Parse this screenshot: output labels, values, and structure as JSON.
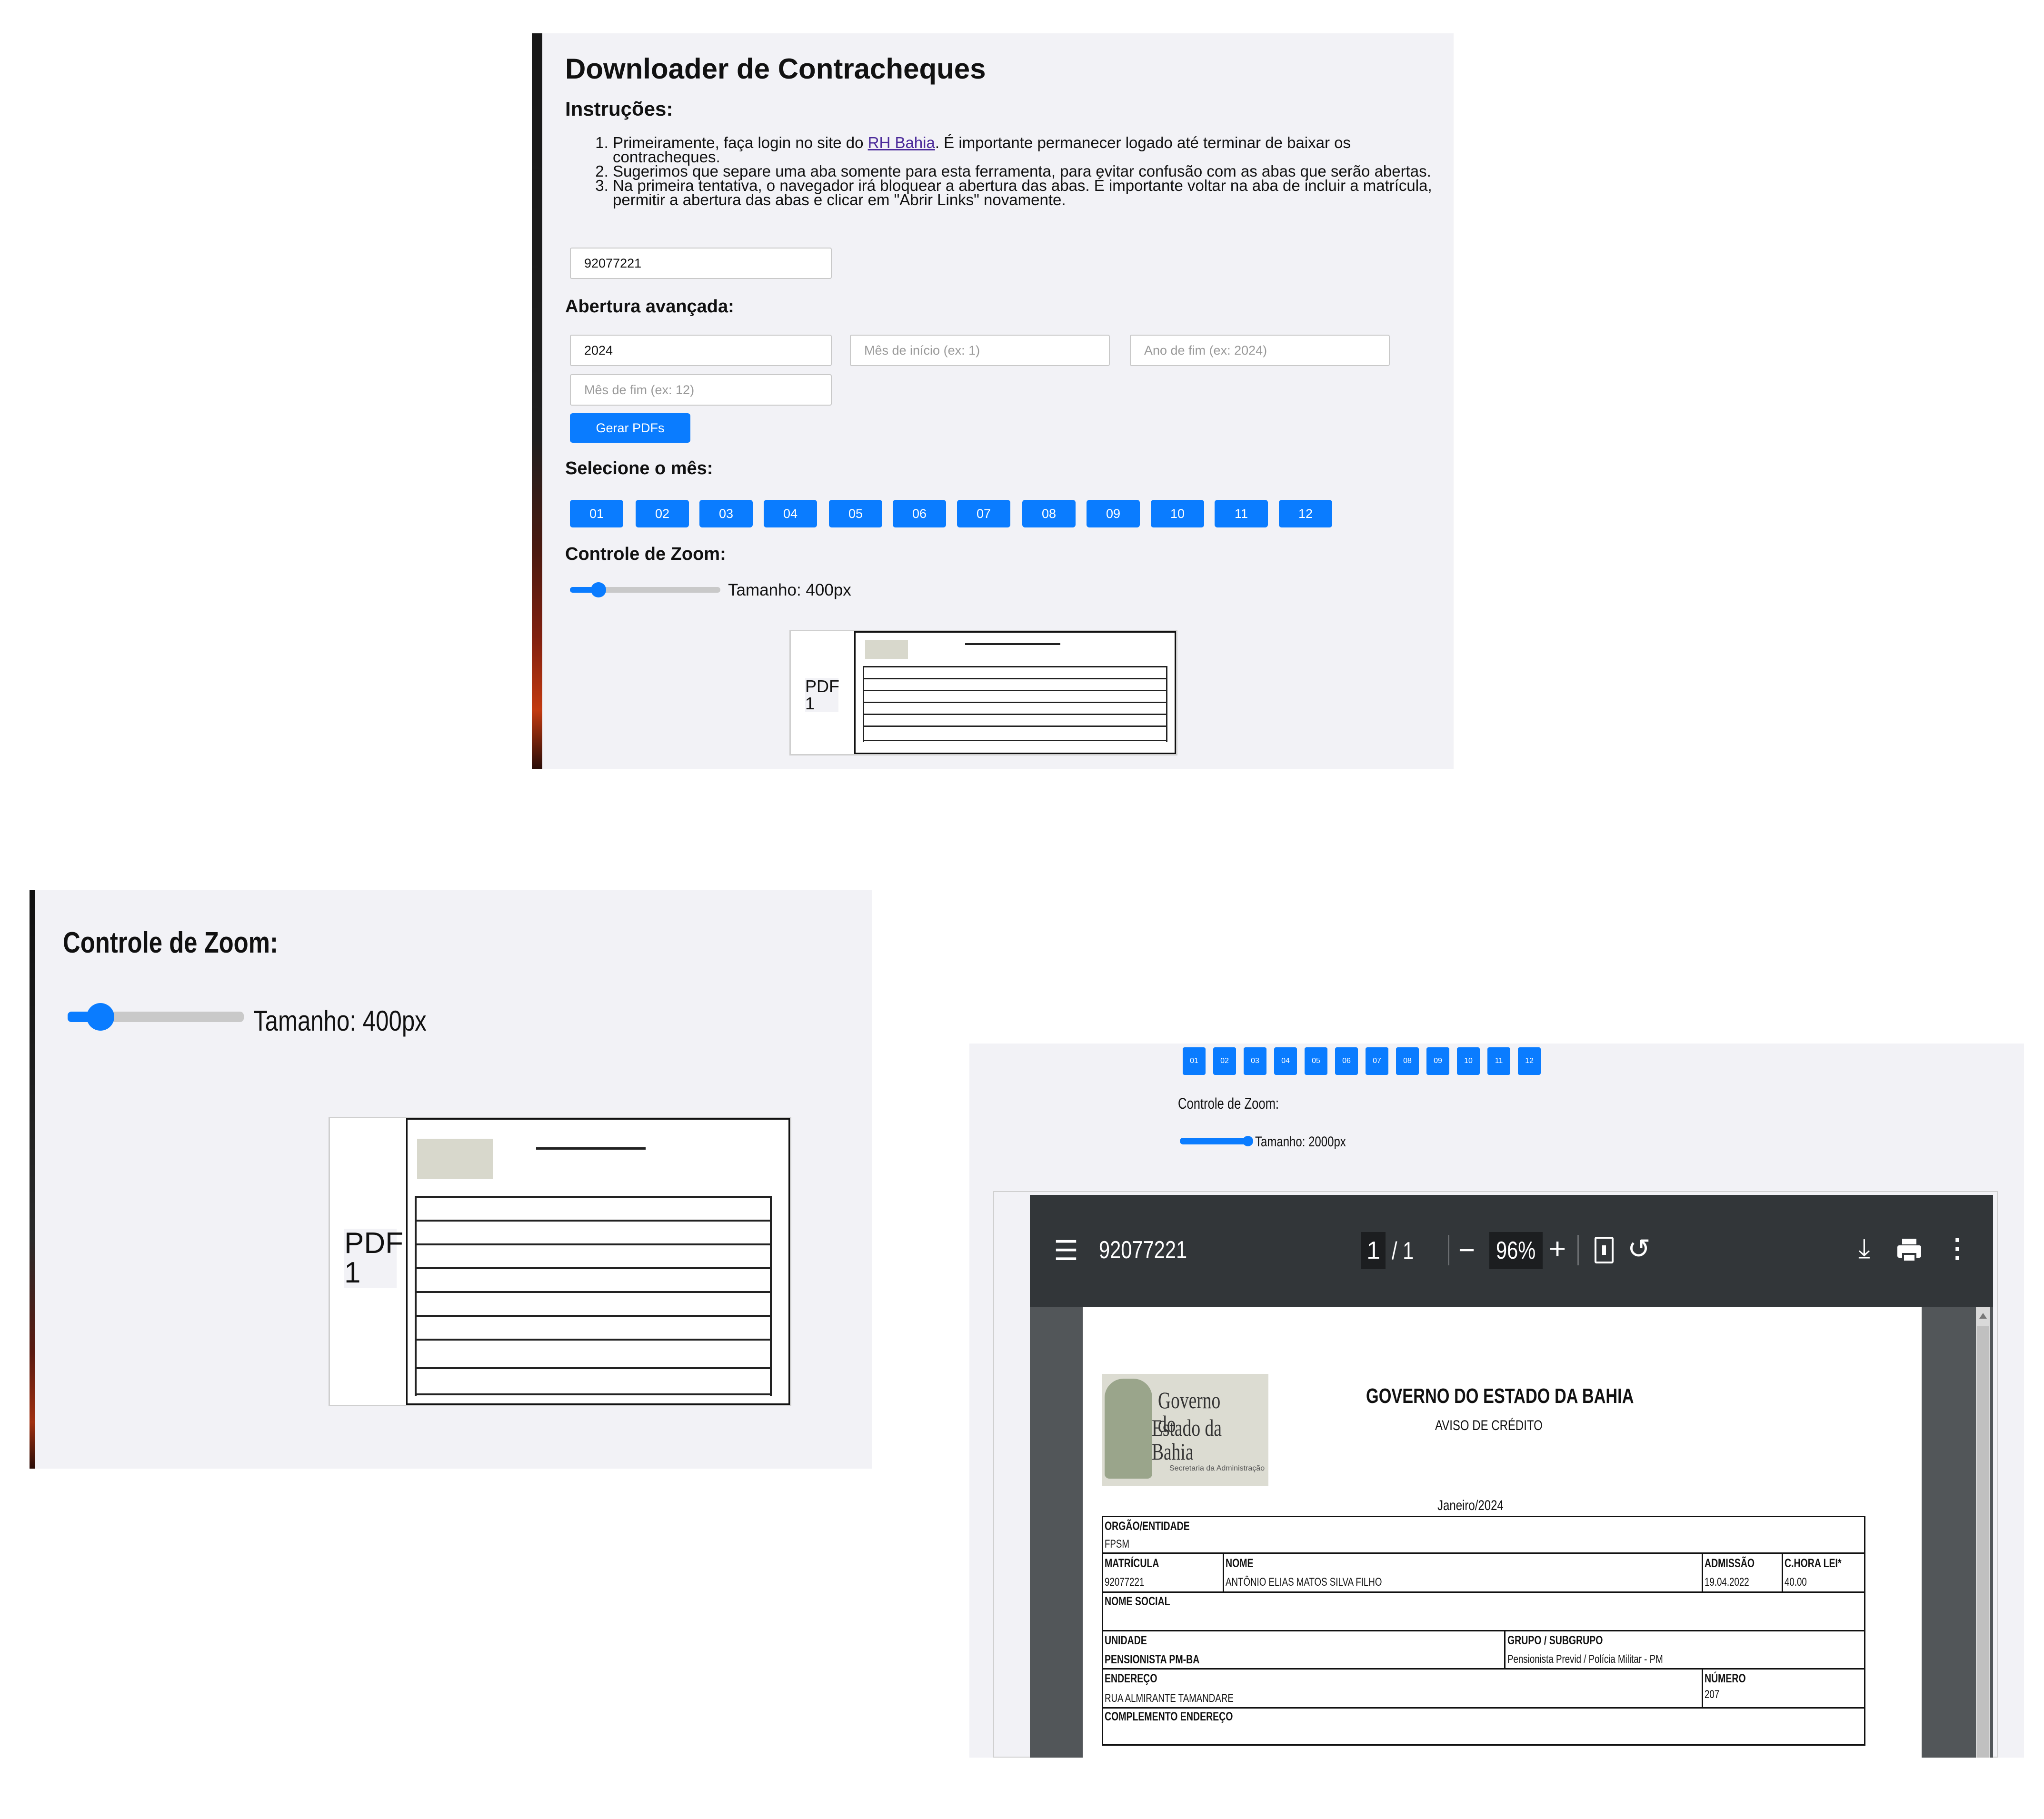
{
  "app": {
    "title": "Downloader de Contracheques",
    "instructions_heading": "Instruções:",
    "instructions": {
      "step1_pre": "Primeiramente, faça login no site do ",
      "step1_link": "RH Bahia",
      "step1_post": ". É importante permanecer logado até terminar de baixar os contracheques.",
      "step2": "Sugerimos que separe uma aba somente para esta ferramenta, para evitar confusão com as abas que serão abertas.",
      "step3": "Na primeira tentativa, o navegador irá bloquear a abertura das abas. É importante voltar na aba de incluir a matrícula, permitir a abertura das abas e clicar em \"Abrir Links\" novamente."
    },
    "matricula_value": "92077221",
    "advanced_heading": "Abertura avançada:",
    "ano_inicio_value": "2024",
    "mes_inicio_placeholder": "Mês de início (ex: 1)",
    "ano_fim_placeholder": "Ano de fim (ex: 2024)",
    "mes_fim_placeholder": "Mês de fim (ex: 12)",
    "gerar_label": "Gerar PDFs",
    "month_heading": "Selecione o mês:",
    "months": [
      "01",
      "02",
      "03",
      "04",
      "05",
      "06",
      "07",
      "08",
      "09",
      "10",
      "11",
      "12"
    ],
    "zoom_heading": "Controle de Zoom:",
    "zoom_label": "Tamanho: 400px",
    "zoom_level": 0.2,
    "thumb_label": "PDF 1"
  },
  "zoomed_panel": {
    "zoom_heading": "Controle de Zoom:",
    "zoom_label": "Tamanho: 400px",
    "thumb_label": "PDF 1"
  },
  "viewer_panel": {
    "months": [
      "01",
      "02",
      "03",
      "04",
      "05",
      "06",
      "07",
      "08",
      "09",
      "10",
      "11",
      "12"
    ],
    "zoom_heading": "Controle de Zoom:",
    "zoom_label": "Tamanho: 2000px",
    "zoom_level": 1.0,
    "pdf_title": "92077221",
    "page_current": "1",
    "page_total": "/ 1",
    "zoom_percent": "96%",
    "icons": [
      "menu-icon",
      "zoom-out-icon",
      "zoom-in-icon",
      "fit-page-icon",
      "rotate-icon",
      "download-icon",
      "print-icon",
      "more-icon"
    ]
  },
  "document": {
    "logo_line1": "Governo do",
    "logo_line2": "Estado da Bahia",
    "logo_sub": "Secretaria da Administração",
    "header": "GOVERNO DO ESTADO DA BAHIA",
    "subheader": "AVISO DE CRÉDITO",
    "period": "Janeiro/2024",
    "orgao_label": "ORGÃO/ENTIDADE",
    "orgao_value": "FPSM",
    "matricula_label": "MATRÍCULA",
    "matricula_value": "92077221",
    "nome_label": "NOME",
    "nome_value": "ANTÔNIO ELIAS MATOS SILVA FILHO",
    "admissao_label": "ADMISSÃO",
    "admissao_value": "19.04.2022",
    "chora_label": "C.HORA LEI*",
    "chora_value": "40.00",
    "nome_social_label": "NOME SOCIAL",
    "unidade_label": "UNIDADE",
    "unidade_value": "PENSIONISTA PM-BA",
    "grupo_label": "GRUPO / SUBGRUPO",
    "grupo_value": "Pensionista Previd / Polícia Militar - PM",
    "endereco_label": "ENDEREÇO",
    "endereco_value": "RUA ALMIRANTE TAMANDARE",
    "numero_label": "NÚMERO",
    "numero_value": "207",
    "complemento_label": "COMPLEMENTO ENDEREÇO"
  },
  "colors": {
    "accent": "#0a7cff",
    "panel_bg": "#f2f2f6",
    "viewer_toolbar": "#323639",
    "viewer_bg": "#525659"
  }
}
